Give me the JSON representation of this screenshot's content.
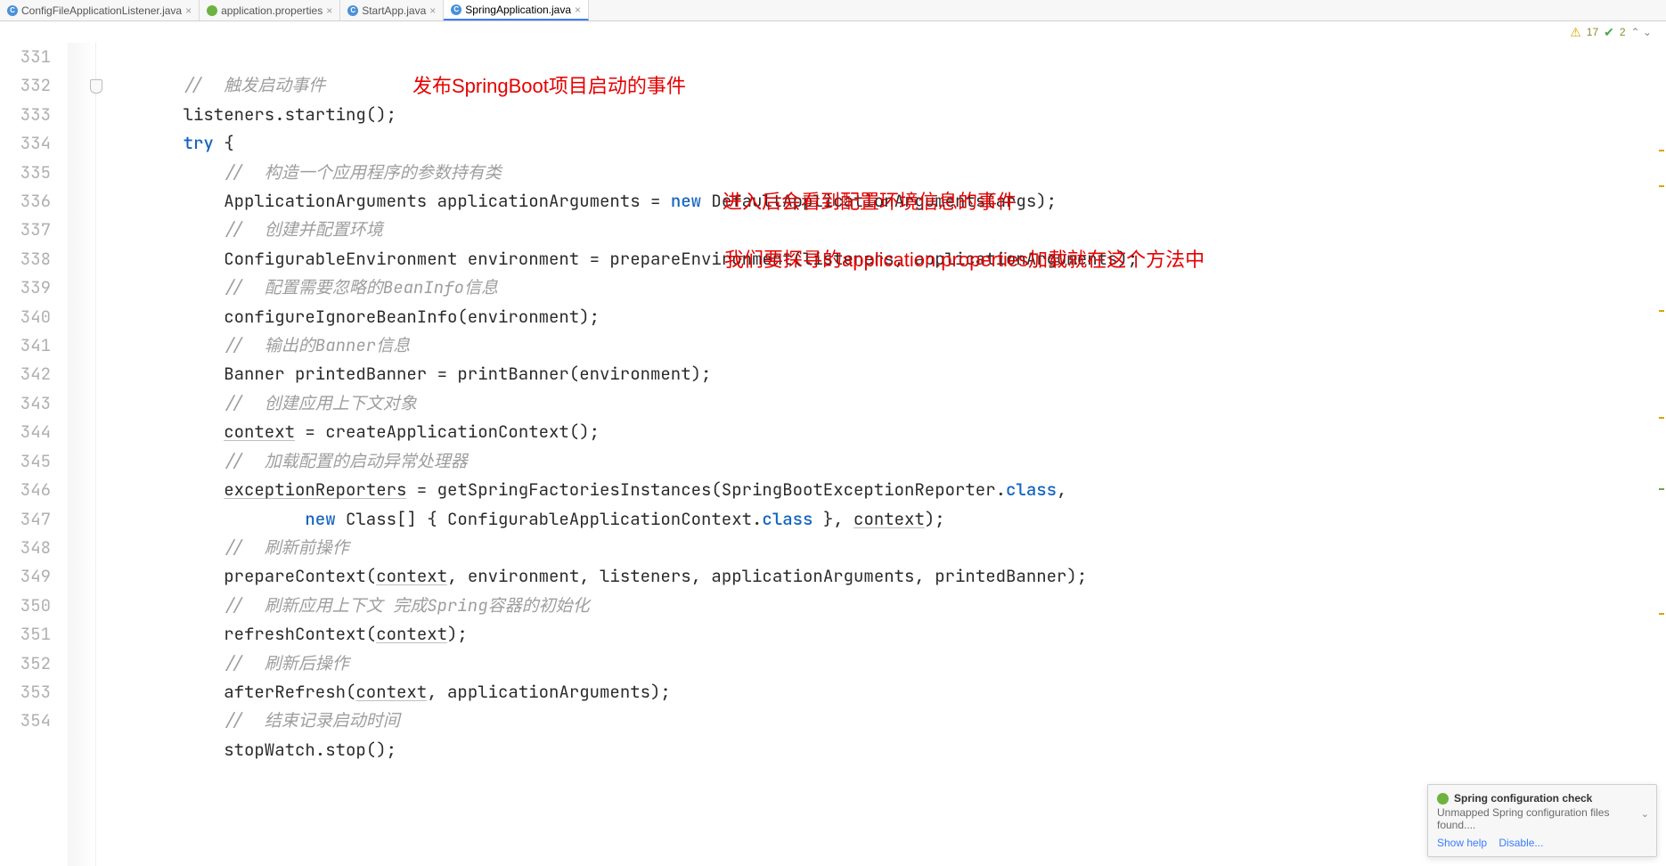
{
  "tabs": [
    {
      "icon": "class",
      "label": "ConfigFileApplicationListener.java",
      "active": false
    },
    {
      "icon": "leaf",
      "label": "application.properties",
      "active": false
    },
    {
      "icon": "class",
      "label": "StartApp.java",
      "active": false
    },
    {
      "icon": "class",
      "label": "SpringApplication.java",
      "active": true
    }
  ],
  "status": {
    "warn_count": "17",
    "green_count": "2"
  },
  "line_start": 331,
  "line_end": 354,
  "annotations": {
    "a1": "发布SpringBoot项目启动的事件",
    "a2": "进入后会看到配置环境信息的事件",
    "a3": "我们要探寻的application.properties加载就在这个方法中"
  },
  "code": {
    "c331": "//  触发启动事件",
    "l332a": "listeners.starting();",
    "kw_try": "try",
    "l333b": " {",
    "c334": "//  构造一个应用程序的参数持有类",
    "l335a": "ApplicationArguments applicationArguments = ",
    "kw_new1": "new",
    "l335b": " DefaultApplicationArguments(args);",
    "c336": "//  创建并配置环境",
    "l337": "ConfigurableEnvironment environment = prepareEnvironment(listeners, applicationArguments);",
    "c338": "//  配置需要忽略的BeanInfo信息",
    "l339": "configureIgnoreBeanInfo(environment);",
    "c340": "//  输出的Banner信息",
    "l341": "Banner printedBanner = printBanner(environment);",
    "c342": "//  创建应用上下文对象",
    "u343": "context",
    "l343b": " = createApplicationContext();",
    "c344": "//  加载配置的启动异常处理器",
    "u345": "exceptionReporters",
    "l345b": " = getSpringFactoriesInstances(SpringBootExceptionReporter.",
    "kw_class1": "class",
    "l345c": ",",
    "kw_new2": "new",
    "l346b": " Class[] { ConfigurableApplicationContext.",
    "kw_class2": "class",
    "l346c": " }, ",
    "u346": "context",
    "l346d": ");",
    "c347": "//  刷新前操作",
    "l348a": "prepareContext(",
    "u348": "context",
    "l348b": ", environment, listeners, applicationArguments, printedBanner);",
    "c349": "//  刷新应用上下文 完成Spring容器的初始化",
    "l350a": "refreshContext(",
    "u350": "context",
    "l350b": ");",
    "c351": "//  刷新后操作",
    "l352a": "afterRefresh(",
    "u352": "context",
    "l352b": ", applicationArguments);",
    "c353": "//  结束记录启动时间",
    "l354": "stopWatch.stop();"
  },
  "notification": {
    "title": "Spring configuration check",
    "body": "Unmapped Spring configuration files found....",
    "link1": "Show help",
    "link2": "Disable..."
  }
}
